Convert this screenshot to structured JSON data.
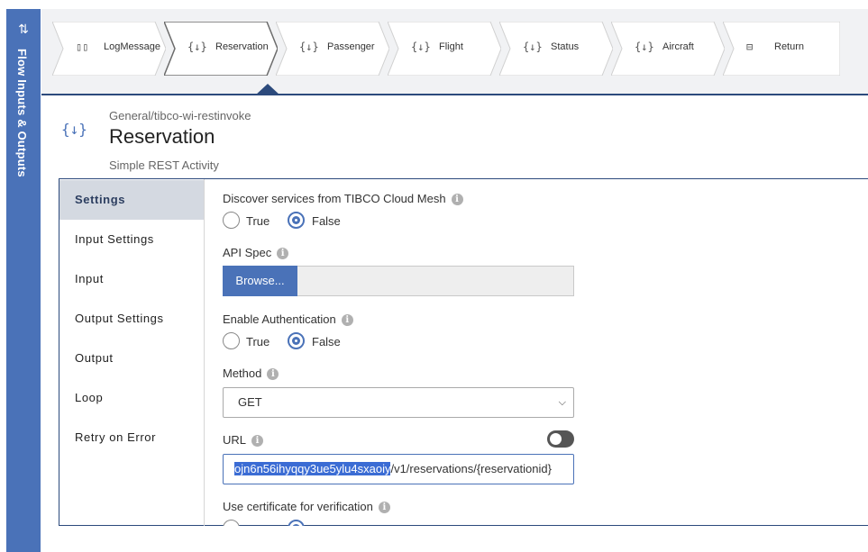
{
  "rail": {
    "label": "Flow Inputs & Outputs",
    "icon": "swap-arrows-icon"
  },
  "flow": {
    "steps": [
      {
        "label": "LogMessage",
        "icon": "book-icon"
      },
      {
        "label": "Reservation",
        "icon": "rest-activity-icon",
        "active": true
      },
      {
        "label": "Passenger",
        "icon": "rest-activity-icon"
      },
      {
        "label": "Flight",
        "icon": "rest-activity-icon"
      },
      {
        "label": "Status",
        "icon": "rest-activity-icon"
      },
      {
        "label": "Aircraft",
        "icon": "rest-activity-icon"
      },
      {
        "label": "Return",
        "icon": "return-icon"
      }
    ]
  },
  "activity": {
    "path": "General/tibco-wi-restinvoke",
    "title": "Reservation",
    "subtitle": "Simple REST Activity",
    "icon": "{↓}"
  },
  "nav": {
    "items": [
      {
        "label": "Settings"
      },
      {
        "label": "Input Settings"
      },
      {
        "label": "Input"
      },
      {
        "label": "Output Settings"
      },
      {
        "label": "Output"
      },
      {
        "label": "Loop"
      },
      {
        "label": "Retry on Error"
      }
    ],
    "active": "Settings"
  },
  "settings": {
    "discover": {
      "label": "Discover services from TIBCO Cloud Mesh",
      "true_label": "True",
      "false_label": "False",
      "value": "False"
    },
    "api_spec": {
      "label": "API Spec",
      "button": "Browse..."
    },
    "auth": {
      "label": "Enable Authentication",
      "true_label": "True",
      "false_label": "False",
      "value": "False"
    },
    "method": {
      "label": "Method",
      "value": "GET"
    },
    "url": {
      "label": "URL",
      "selected_part": "ojn6n56ihyqqy3ue5ylu4sxaoiy",
      "rest": "/v1/reservations/{reservationid}"
    },
    "cert": {
      "label": "Use certificate for verification"
    }
  },
  "colors": {
    "accent": "#4a72b8",
    "dark": "#2c4a7c",
    "nav_active": "#d4d9e1"
  }
}
